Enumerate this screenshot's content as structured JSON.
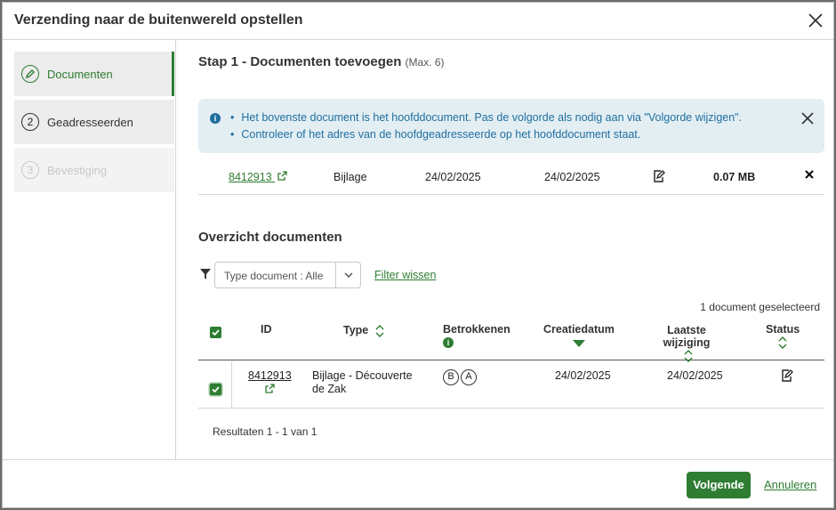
{
  "dialog": {
    "title": "Verzending naar de buitenwereld opstellen"
  },
  "sidebar": {
    "steps": [
      {
        "number": "",
        "label": "Documenten",
        "state": "active",
        "icon": "pencil-icon"
      },
      {
        "number": "2",
        "label": "Geadresseerden",
        "state": "default"
      },
      {
        "number": "3",
        "label": "Bevestiging",
        "state": "disabled"
      }
    ]
  },
  "main": {
    "step_title": "Stap 1 - Documenten toevoegen",
    "step_max": "(Max. 6)",
    "info": {
      "items": [
        "Het bovenste document is het hoofddocument. Pas de volgorde als nodig aan via \"Volgorde wijzigen\".",
        "Controleer of het adres van de hoofdgeadresseerde op het hoofddocument staat."
      ]
    },
    "selected_document": {
      "id": "8412913",
      "type": "Bijlage",
      "created": "24/02/2025",
      "modified": "24/02/2025",
      "size": "0.07 MB"
    },
    "overview_title": "Overzicht documenten",
    "filter": {
      "type_value": "Type document : Alle",
      "clear_label": "Filter wissen"
    },
    "selected_count": "1 document geselecteerd",
    "table": {
      "headers": {
        "id": "ID",
        "type": "Type",
        "involved": "Betrokkenen",
        "created": "Creatiedatum",
        "modified_line1": "Laatste",
        "modified_line2": "wijziging",
        "status": "Status"
      },
      "rows": [
        {
          "id": "8412913",
          "type_line1": "Bijlage - Découverte",
          "type_line2": "de Zak",
          "involved": [
            "B",
            "A"
          ],
          "created": "24/02/2025",
          "modified": "24/02/2025"
        }
      ]
    },
    "results": "Resultaten 1 - 1 van 1"
  },
  "footer": {
    "next_label": "Volgende",
    "cancel_label": "Annuleren"
  },
  "colors": {
    "accent": "#2e7d32",
    "info_bg": "#e3eef3",
    "info_text": "#1f6f9e"
  }
}
